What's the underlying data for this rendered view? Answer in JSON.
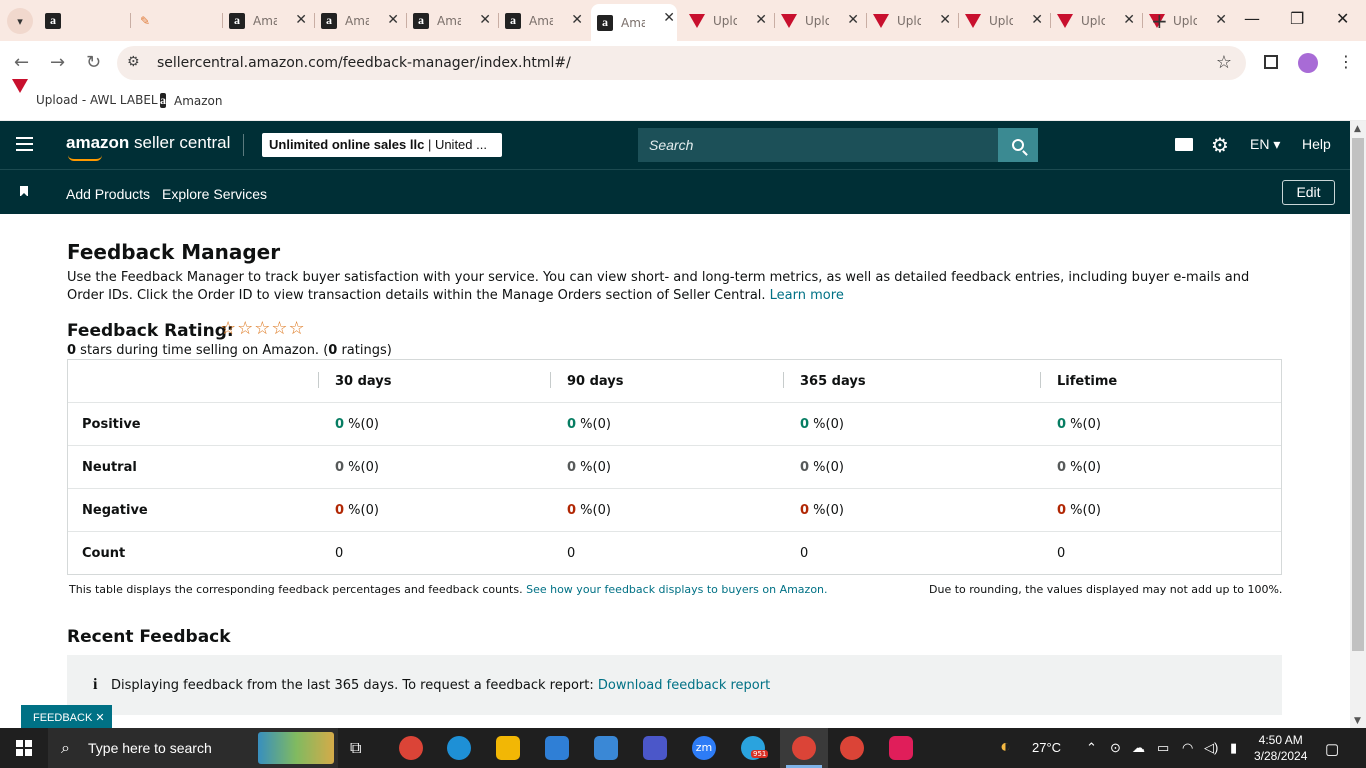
{
  "browser": {
    "tabs": [
      {
        "icon": "amazon-icon",
        "title": ""
      },
      {
        "icon": "pencil-icon",
        "title": ""
      },
      {
        "icon": "amazon-icon",
        "title": "Ama"
      },
      {
        "icon": "amazon-icon",
        "title": "Ama"
      },
      {
        "icon": "amazon-icon",
        "title": "Ama"
      },
      {
        "icon": "amazon-icon",
        "title": "Ama"
      },
      {
        "icon": "amazon-icon",
        "title": "Ama",
        "active": true
      },
      {
        "icon": "upload-icon",
        "title": "Uplo"
      },
      {
        "icon": "upload-icon",
        "title": "Uplo"
      },
      {
        "icon": "upload-icon",
        "title": "Uplo"
      },
      {
        "icon": "upload-icon",
        "title": "Uplo"
      },
      {
        "icon": "upload-icon",
        "title": "Uplo"
      },
      {
        "icon": "upload-icon",
        "title": "Uplo"
      }
    ],
    "url": "sellercentral.amazon.com/feedback-manager/index.html#/",
    "bookmarks": [
      {
        "icon": "upload-icon",
        "label": "Upload - AWL LABEL"
      },
      {
        "icon": "amazon-icon",
        "label": "Amazon"
      }
    ]
  },
  "header": {
    "logo_amazon": "amazon",
    "logo_sc": "seller central",
    "account_name": "Unlimited online sales llc",
    "account_region": "| United ...",
    "search_placeholder": "Search",
    "language": "EN ▾",
    "help": "Help"
  },
  "nav": {
    "links": [
      "Add Products",
      "Explore Services"
    ],
    "edit": "Edit"
  },
  "page": {
    "title": "Feedback Manager",
    "intro": "Use the Feedback Manager to track buyer satisfaction with your service. You can view short- and long-term metrics, as well as detailed feedback entries, including buyer e-mails and Order IDs. Click the Order ID to view transaction details within the Manage Orders section of Seller Central.",
    "learn_more": "Learn more",
    "rating_label": "Feedback Rating:",
    "stars": "☆☆☆☆☆",
    "stars_count": "0",
    "stars_text": " stars during time selling on Amazon. (",
    "ratings_count": "0",
    "ratings_text": " ratings)",
    "table": {
      "headers": [
        "30 days",
        "90 days",
        "365 days",
        "Lifetime"
      ],
      "rows": [
        {
          "label": "Positive",
          "kind": "green",
          "values": [
            "0",
            "0",
            "0",
            "0"
          ],
          "suffix": " %(0)"
        },
        {
          "label": "Neutral",
          "kind": "gray",
          "values": [
            "0",
            "0",
            "0",
            "0"
          ],
          "suffix": " %(0)"
        },
        {
          "label": "Negative",
          "kind": "red",
          "values": [
            "0",
            "0",
            "0",
            "0"
          ],
          "suffix": " %(0)"
        },
        {
          "label": "Count",
          "kind": "plain",
          "values": [
            "0",
            "0",
            "0",
            "0"
          ],
          "suffix": ""
        }
      ]
    },
    "note_left": "This table displays the corresponding feedback percentages and feedback counts.",
    "note_left_link": "See how your feedback displays to buyers on Amazon.",
    "note_right": "Due to rounding, the values displayed may not add up to 100%.",
    "recent_title": "Recent Feedback",
    "info_icon": "i",
    "info_text": "Displaying feedback from the last 365 days. To request a feedback report: ",
    "info_link": "Download feedback report",
    "feedback_tab": "FEEDBACK ✕"
  },
  "taskbar": {
    "search_placeholder": "Type here to search",
    "weather": "27°C",
    "time": "4:50 AM",
    "date": "3/28/2024",
    "telegram_badge": "951",
    "zoom_label": "zm"
  },
  "colors": {
    "sc_header": "#002f36",
    "link": "#007185",
    "positive": "#067d62",
    "negative": "#b12704",
    "star": "#de7921"
  }
}
